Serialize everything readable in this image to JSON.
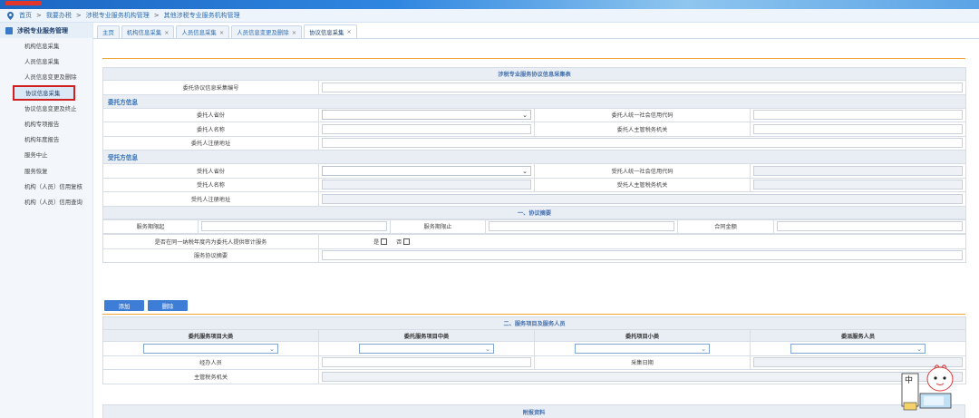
{
  "breadcrumb": {
    "items": [
      "首页",
      "我要办税",
      "涉税专业服务机构管理",
      "其他涉税专业服务机构管理"
    ],
    "separator": ">"
  },
  "sidebar": {
    "title": "涉税专业服务管理",
    "items": [
      {
        "label": "机构信息采集"
      },
      {
        "label": "人员信息采集"
      },
      {
        "label": "人员信息变更及删除"
      },
      {
        "label": "协议信息采集"
      },
      {
        "label": "协议信息变更及终止"
      },
      {
        "label": "机构专项报告"
      },
      {
        "label": "机构年度报告"
      },
      {
        "label": "服务中止"
      },
      {
        "label": "服务恢复"
      },
      {
        "label": "机构（人员）信用复核"
      },
      {
        "label": "机构（人员）信用查询"
      }
    ]
  },
  "tabs": [
    {
      "label": "主页",
      "closable": false
    },
    {
      "label": "机构信息采集",
      "closable": true
    },
    {
      "label": "人员信息采集",
      "closable": true
    },
    {
      "label": "人员信息变更及删除",
      "closable": true
    },
    {
      "label": "协议信息采集",
      "closable": true
    }
  ],
  "form": {
    "caption": "涉税专业服务协议信息采集表",
    "agreement_no_label": "委托协议信息采集编号",
    "client_section": "委托方信息",
    "client_province": "委托人省份",
    "client_credit_code": "委托人统一社会信用代码",
    "client_name": "委托人名称",
    "client_tax_authority": "委托人主管税务机关",
    "client_address": "委托人注册地址",
    "agent_section": "受托方信息",
    "agent_province": "受托人省份",
    "agent_credit_code": "受托人统一社会信用代码",
    "agent_name": "受托人名称",
    "agent_tax_authority": "受托人主管税务机关",
    "agent_address": "受托人注册地址",
    "summary_header": "一、协议摘要",
    "period_start": "服务期限起",
    "period_end": "服务期限止",
    "contract_amount": "合同金额",
    "audit_question": "是否在同一纳税年度内为委托人提供审计服务",
    "yes": "是",
    "no": "否",
    "agreement_summary": "服务协议摘要"
  },
  "buttons": {
    "add": "添加",
    "delete": "删除"
  },
  "services": {
    "header": "二、服务项目及服务人员",
    "columns": [
      "委托服务项目大类",
      "委托服务项目中类",
      "委托项目小类",
      "委派服务人员"
    ],
    "handler_label": "经办人员",
    "collect_date_label": "采集日期",
    "tax_authority_label": "主管税务机关"
  },
  "attachments": {
    "header": "附报资料"
  },
  "mascot": {
    "text": "中"
  },
  "colors": {
    "accent": "#3d7dd6",
    "highlight": "#d11f1f",
    "rule": "#f2a53a"
  }
}
